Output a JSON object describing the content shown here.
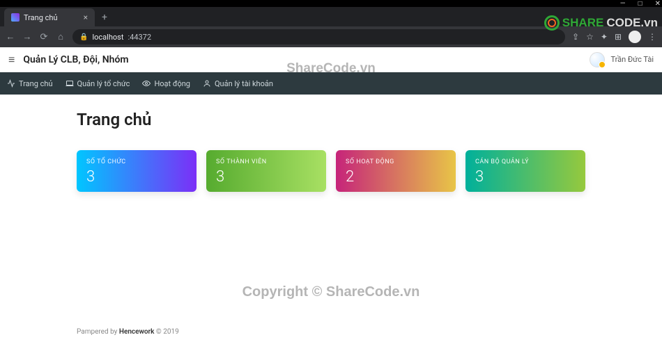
{
  "os": {
    "min": "—",
    "max": "□",
    "close": "✕"
  },
  "browser": {
    "tab_title": "Trang chủ",
    "url_host": "localhost",
    "url_port": ":44372"
  },
  "app": {
    "title": "Quản Lý CLB, Đội, Nhóm",
    "user_name": "Trần Đức Tài"
  },
  "nav": {
    "items": [
      {
        "icon": "activity",
        "label": "Trang chủ"
      },
      {
        "icon": "laptop",
        "label": "Quản lý tổ chức"
      },
      {
        "icon": "eye",
        "label": "Hoạt động"
      },
      {
        "icon": "user",
        "label": "Quản lý tài khoản"
      }
    ]
  },
  "page": {
    "title": "Trang chủ",
    "cards": [
      {
        "label": "SỐ TỔ CHỨC",
        "value": "3"
      },
      {
        "label": "SỐ THÀNH VIÊN",
        "value": "3"
      },
      {
        "label": "SỐ HOẠT ĐỘNG",
        "value": "2"
      },
      {
        "label": "CÁN BỘ QUẢN LÝ",
        "value": "3"
      }
    ]
  },
  "footer": {
    "prefix": "Pampered by ",
    "brand": "Hencework",
    "suffix": " © 2019"
  },
  "watermark": {
    "brand1": "SHARE",
    "brand2": "CODE.vn",
    "center": "ShareCode.vn",
    "bottom": "Copyright © ShareCode.vn"
  }
}
